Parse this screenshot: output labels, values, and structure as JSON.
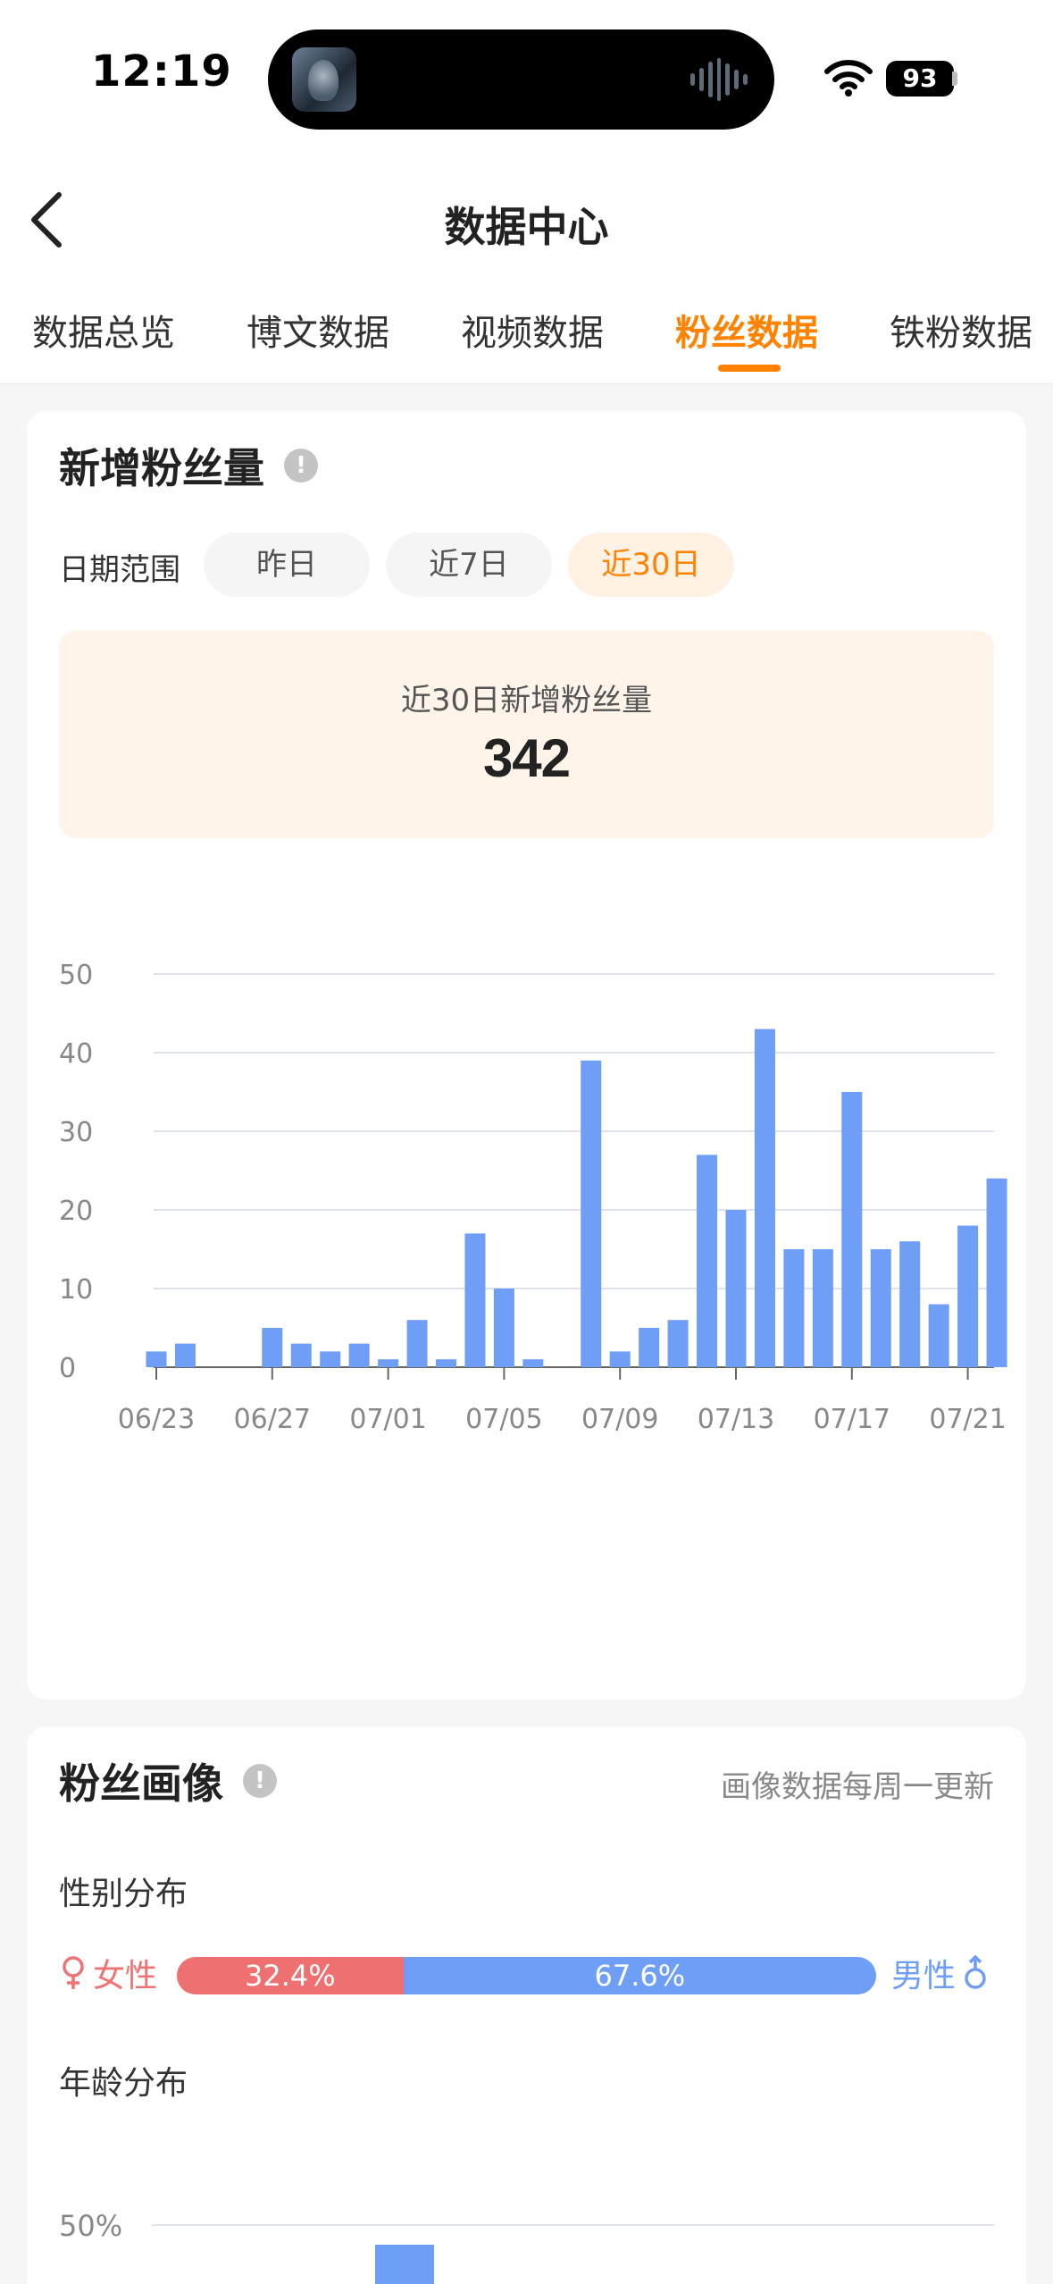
{
  "status_bar": {
    "time": "12:19",
    "battery": "93"
  },
  "nav": {
    "title": "数据中心"
  },
  "tabs": [
    {
      "label": "数据总览",
      "active": false
    },
    {
      "label": "博文数据",
      "active": false
    },
    {
      "label": "视频数据",
      "active": false
    },
    {
      "label": "粉丝数据",
      "active": true
    },
    {
      "label": "铁粉数据",
      "active": false
    }
  ],
  "new_fans": {
    "title": "新增粉丝量",
    "info_icon": "!",
    "date_range_label": "日期范围",
    "chips": [
      {
        "label": "昨日",
        "active": false
      },
      {
        "label": "近7日",
        "active": false
      },
      {
        "label": "近30日",
        "active": true
      }
    ],
    "summary_label": "近30日新增粉丝量",
    "summary_value": "342"
  },
  "chart_data": {
    "type": "bar",
    "categories": [
      "06/23",
      "06/24",
      "06/25",
      "06/26",
      "06/27",
      "06/28",
      "06/29",
      "06/30",
      "07/01",
      "07/02",
      "07/03",
      "07/04",
      "07/05",
      "07/06",
      "07/07",
      "07/08",
      "07/09",
      "07/10",
      "07/11",
      "07/12",
      "07/13",
      "07/14",
      "07/15",
      "07/16",
      "07/17",
      "07/18",
      "07/19",
      "07/20",
      "07/21",
      "07/22"
    ],
    "values": [
      2,
      3,
      0,
      0,
      5,
      3,
      2,
      3,
      1,
      6,
      1,
      17,
      10,
      1,
      0,
      39,
      2,
      5,
      6,
      27,
      20,
      43,
      15,
      15,
      35,
      15,
      16,
      8,
      18,
      24
    ],
    "x_tick_labels": [
      "06/23",
      "06/27",
      "07/01",
      "07/05",
      "07/09",
      "07/13",
      "07/17",
      "07/21"
    ],
    "y_ticks": [
      "0",
      "10",
      "20",
      "30",
      "40",
      "50"
    ],
    "ylim": [
      0,
      50
    ],
    "grid": true,
    "bar_color": "#6e9ef5"
  },
  "portrait": {
    "title": "粉丝画像",
    "info_icon": "!",
    "note": "画像数据每周一更新",
    "gender_title": "性别分布",
    "female_label": "女性",
    "male_label": "男性",
    "female_pct_text": "32.4%",
    "male_pct_text": "67.6%",
    "female_pct": 32.4,
    "male_pct": 67.6,
    "female_color": "#ee7070",
    "male_color": "#6e9ef5",
    "age_title": "年龄分布",
    "age_y_tick": "50%"
  },
  "colors": {
    "accent": "#ff8200",
    "bar": "#6e9ef5"
  }
}
